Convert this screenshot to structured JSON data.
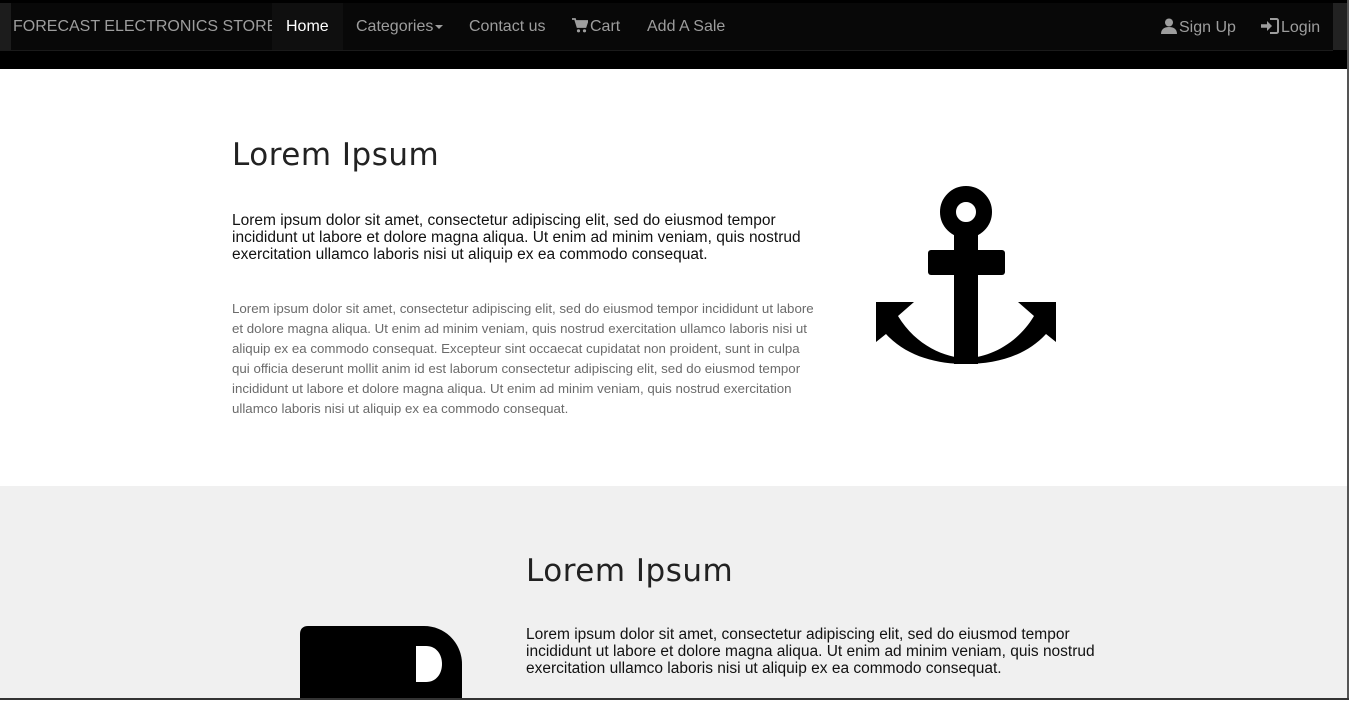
{
  "navbar": {
    "brand": "FORECAST ELECTRONICS STORE",
    "links": [
      {
        "label": "Home"
      },
      {
        "label": "Categories"
      },
      {
        "label": "Contact us"
      },
      {
        "label": "Cart",
        "icon": "shopping-cart-icon"
      },
      {
        "label": "Add A Sale"
      }
    ],
    "right_links": [
      {
        "label": "Sign Up",
        "icon": "user-icon"
      },
      {
        "label": "Login",
        "icon": "log-in-icon"
      }
    ]
  },
  "section1": {
    "heading": "Lorem Ipsum",
    "lead": "Lorem ipsum dolor sit amet, consectetur adipiscing elit, sed do eiusmod tempor incididunt ut labore et dolore magna aliqua. Ut enim ad minim veniam, quis nostrud exercitation ullamco laboris nisi ut aliquip ex ea commodo consequat.",
    "body": "Lorem ipsum dolor sit amet, consectetur adipiscing elit, sed do eiusmod tempor incididunt ut labore et dolore magna aliqua. Ut enim ad minim veniam, quis nostrud exercitation ullamco laboris nisi ut aliquip ex ea commodo consequat. Excepteur sint occaecat cupidatat non proident, sunt in culpa qui officia deserunt mollit anim id est laborum consectetur adipiscing elit, sed do eiusmod tempor incididunt ut labore et dolore magna aliqua. Ut enim ad minim veniam, quis nostrud exercitation ullamco laboris nisi ut aliquip ex ea commodo consequat.",
    "icon": "anchor-icon"
  },
  "section2": {
    "heading": "Lorem Ipsum",
    "lead": "Lorem ipsum dolor sit amet, consectetur adipiscing elit, sed do eiusmod tempor incididunt ut labore et dolore magna aliqua. Ut enim ad minim veniam, quis nostrud exercitation ullamco laboris nisi ut aliquip ex ea commodo consequat.",
    "icon": "usb-drive-icon"
  },
  "colors": {
    "navbar_bg": "#080808",
    "nav_text": "#9d9d9d",
    "nav_active_text": "#ffffff",
    "section2_bg": "#f0f0f0"
  }
}
